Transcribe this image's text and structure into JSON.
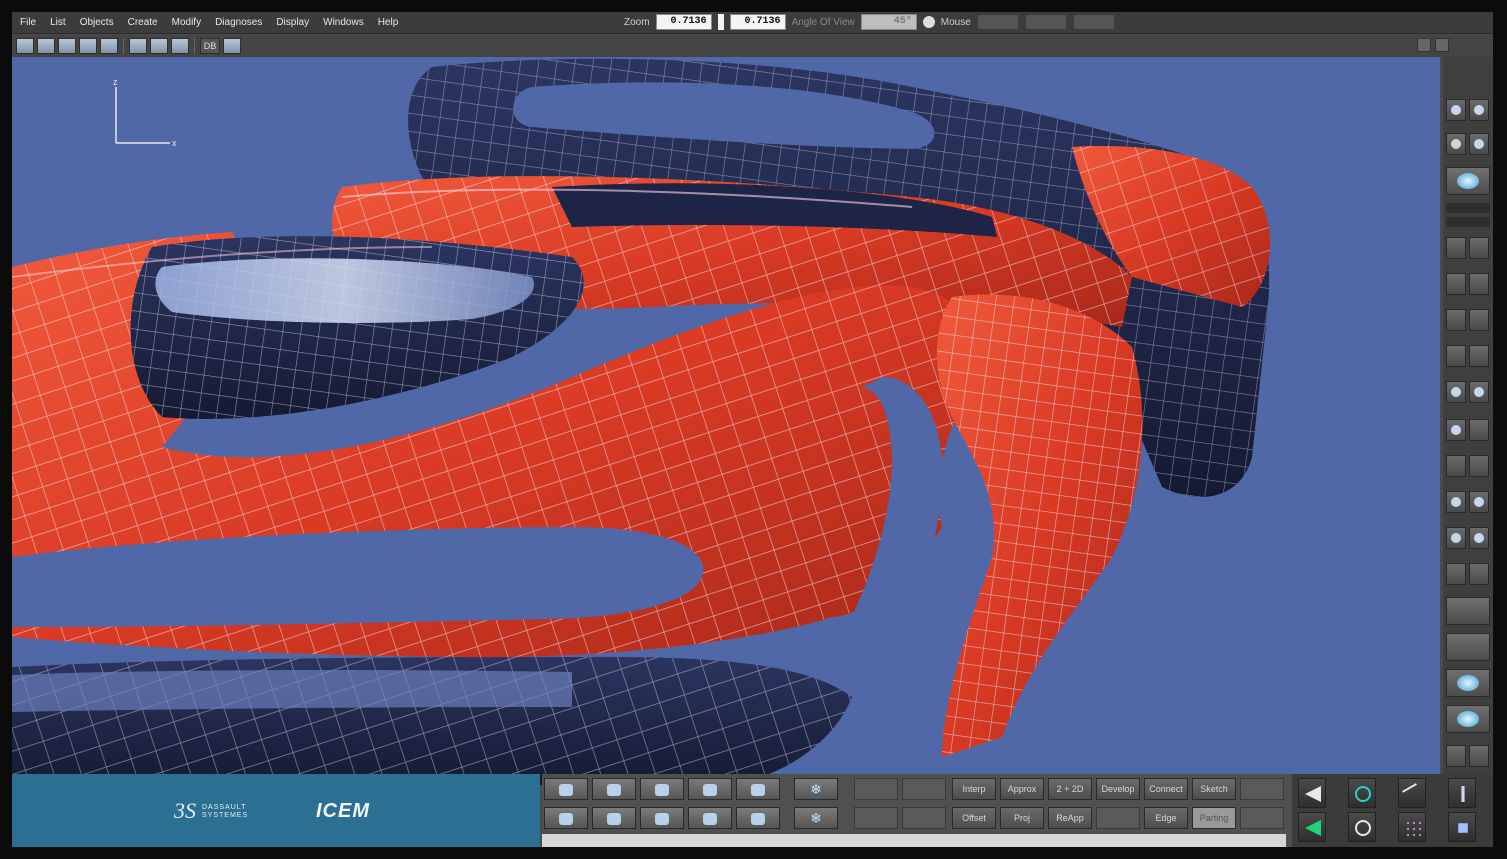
{
  "menu": {
    "items": [
      "File",
      "List",
      "Objects",
      "Create",
      "Modify",
      "Diagnoses",
      "Display",
      "Windows",
      "Help"
    ]
  },
  "zoom": {
    "label": "Zoom",
    "value1": "0.7136",
    "value2": "0.7136",
    "angle_label": "Angle Of View",
    "angle_value": "45°",
    "mouse_label": "Mouse"
  },
  "toolbar": {
    "db_label": "DB"
  },
  "viewport": {
    "axis_z": "z",
    "axis_x": "x",
    "background_color": "#5168a8",
    "surface_color": "#e0432a"
  },
  "commands": {
    "row1": [
      "Interp",
      "Approx",
      "2 + 2D",
      "Develop",
      "Connect",
      "Sketch"
    ],
    "row2": [
      "Offset",
      "Proj",
      "ReApp",
      "",
      "Edge",
      "Parting"
    ]
  },
  "logos": {
    "ds_mark": "3S",
    "ds_text": "DASSAULT\nSYSTEMES",
    "icem": "ICEM"
  },
  "icons": {
    "left_tools_row1": [
      "points-icon",
      "curve-icon",
      "eye-icon",
      "pointer-icon",
      "copy-icon",
      "snowflake-icon"
    ],
    "left_tools_row2": [
      "folder-icon",
      "move-icon",
      "spline-icon",
      "link-icon",
      "grid-icon",
      "snowflake-icon"
    ],
    "right_panel": [
      "eye-icon",
      "surface-icon",
      "sphere-icon",
      "pin-icon",
      "shade-icon",
      "z-icon",
      "zoom-icon"
    ],
    "bottom_right": [
      "flip-icon",
      "rotate-icon",
      "project-icon",
      "slash-icon",
      "mirror-icon",
      "scale-icon",
      "dots-icon",
      "transform-icon"
    ]
  }
}
